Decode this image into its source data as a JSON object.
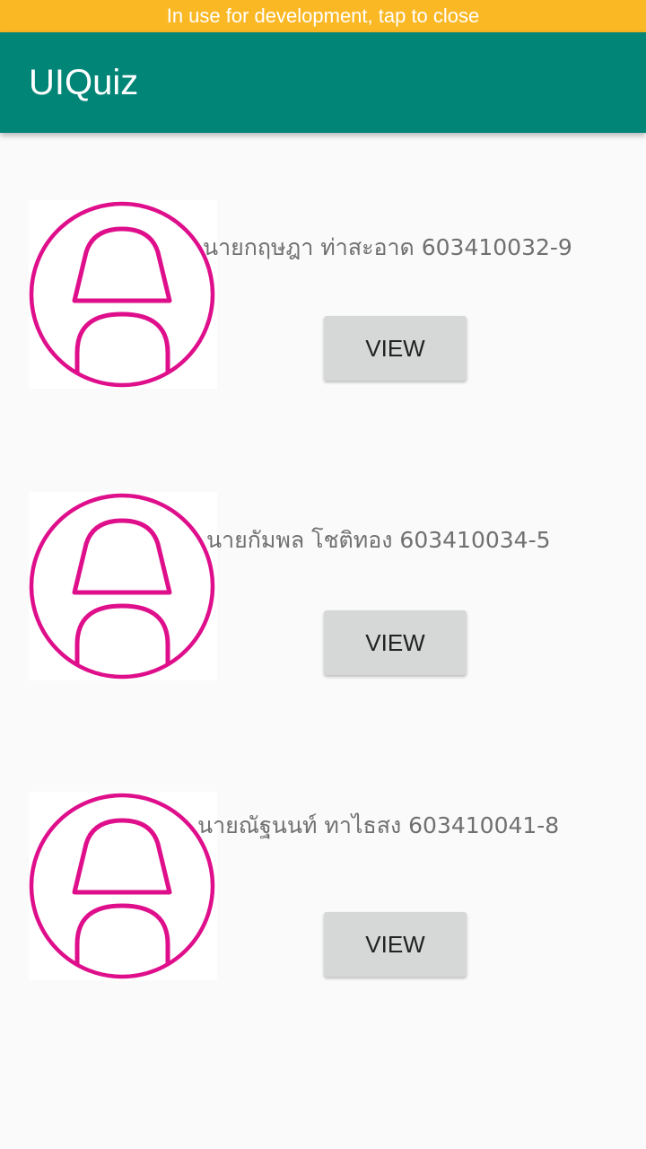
{
  "dev_banner": {
    "text": "In use for development, tap to close"
  },
  "app_bar": {
    "title": "UIQuiz"
  },
  "colors": {
    "banner": "#fbb825",
    "app_bar": "#008577",
    "avatar_stroke": "#df0f8c",
    "button": "#d6d7d7"
  },
  "students": [
    {
      "name": "นายกฤษฎา ท่าสะอาด 603410032-9",
      "button_label": "VIEW",
      "icon": "person-outline-icon"
    },
    {
      "name": "นายกัมพล โชติทอง 603410034-5",
      "button_label": "VIEW",
      "icon": "person-outline-icon"
    },
    {
      "name": "นายณัฐนนท์ ทาไธสง 603410041-8",
      "button_label": "VIEW",
      "icon": "person-outline-icon"
    }
  ]
}
